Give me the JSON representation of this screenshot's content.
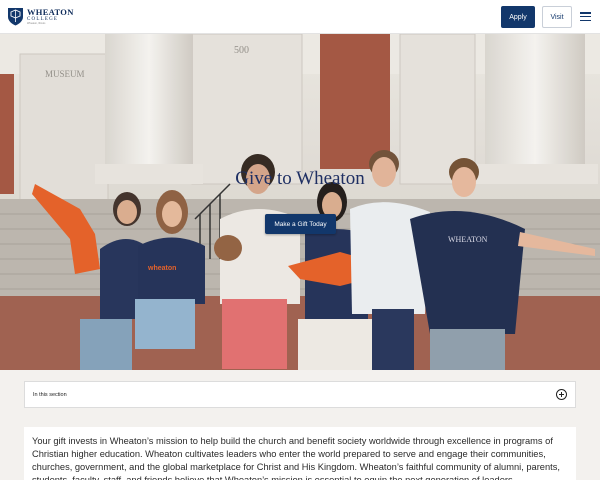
{
  "header": {
    "logo": {
      "name": "WHEATON",
      "sub": "COLLEGE",
      "tag": "Wheaton, Illinois"
    },
    "apply_label": "Apply",
    "visit_label": "Visit"
  },
  "hero": {
    "title": "Give to Wheaton",
    "gift_button": "Make a Gift Today"
  },
  "section_nav": {
    "label": "In this section"
  },
  "intro": {
    "text": "Your gift invests in Wheaton’s mission to help build the church and benefit society worldwide through excellence in programs of Christian higher education. Wheaton cultivates leaders who enter the world prepared to serve and engage their communities, churches, government, and the global marketplace for Christ and His Kingdom. Wheaton’s faithful community of alumni, parents, students, faculty, staff, and friends believe that Wheaton’s mission is essential to equip the next generation of leaders."
  },
  "colors": {
    "brand_navy": "#12376b",
    "brand_orange": "#e35a1f"
  }
}
